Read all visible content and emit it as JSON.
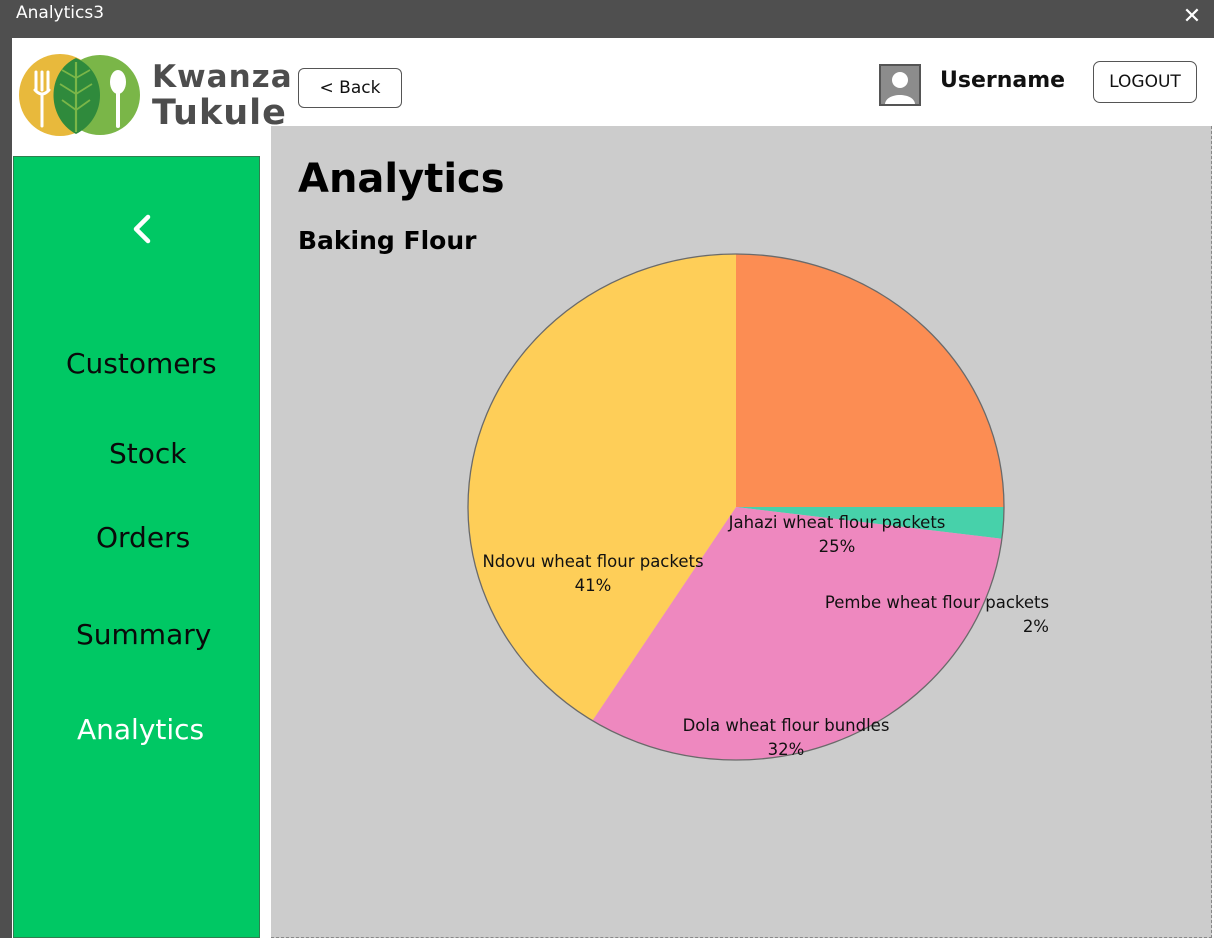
{
  "window": {
    "title": "Analytics3",
    "close_glyph": "✕"
  },
  "brand": {
    "line1": "Kwanza",
    "line2": "Tukule",
    "colors": {
      "yellow": "#e8b93c",
      "green": "#7ab648",
      "dark_green": "#2f8a3c",
      "text": "#4d4d4d"
    }
  },
  "header": {
    "back_label": "< Back",
    "username": "Username",
    "logout_label": "LOGOUT"
  },
  "sidebar": {
    "back_icon": "chevron-left-icon",
    "items": [
      {
        "label": "Customers",
        "active": false
      },
      {
        "label": "Stock",
        "active": false
      },
      {
        "label": "Orders",
        "active": false
      },
      {
        "label": "Summary",
        "active": false
      },
      {
        "label": "Analytics",
        "active": true
      }
    ]
  },
  "main": {
    "title": "Analytics",
    "subtitle": "Baking Flour"
  },
  "colors": {
    "sidebar": "#00c864",
    "content_bg": "#cccccc",
    "titlebar": "#4f4f4f"
  },
  "chart_data": {
    "type": "pie",
    "title": "Baking Flour",
    "slices": [
      {
        "label": "Jahazi wheat flour packets",
        "value": 25,
        "pct_label": "25%",
        "color": "#fc8d53"
      },
      {
        "label": "Pembe wheat flour packets",
        "value": 2,
        "pct_label": "2%",
        "color": "#47d1aa"
      },
      {
        "label": "Dola wheat flour bundles",
        "value": 32,
        "pct_label": "32%",
        "color": "#ee88bf"
      },
      {
        "label": "Ndovu wheat flour packets",
        "value": 41,
        "pct_label": "41%",
        "color": "#fece58"
      }
    ]
  }
}
